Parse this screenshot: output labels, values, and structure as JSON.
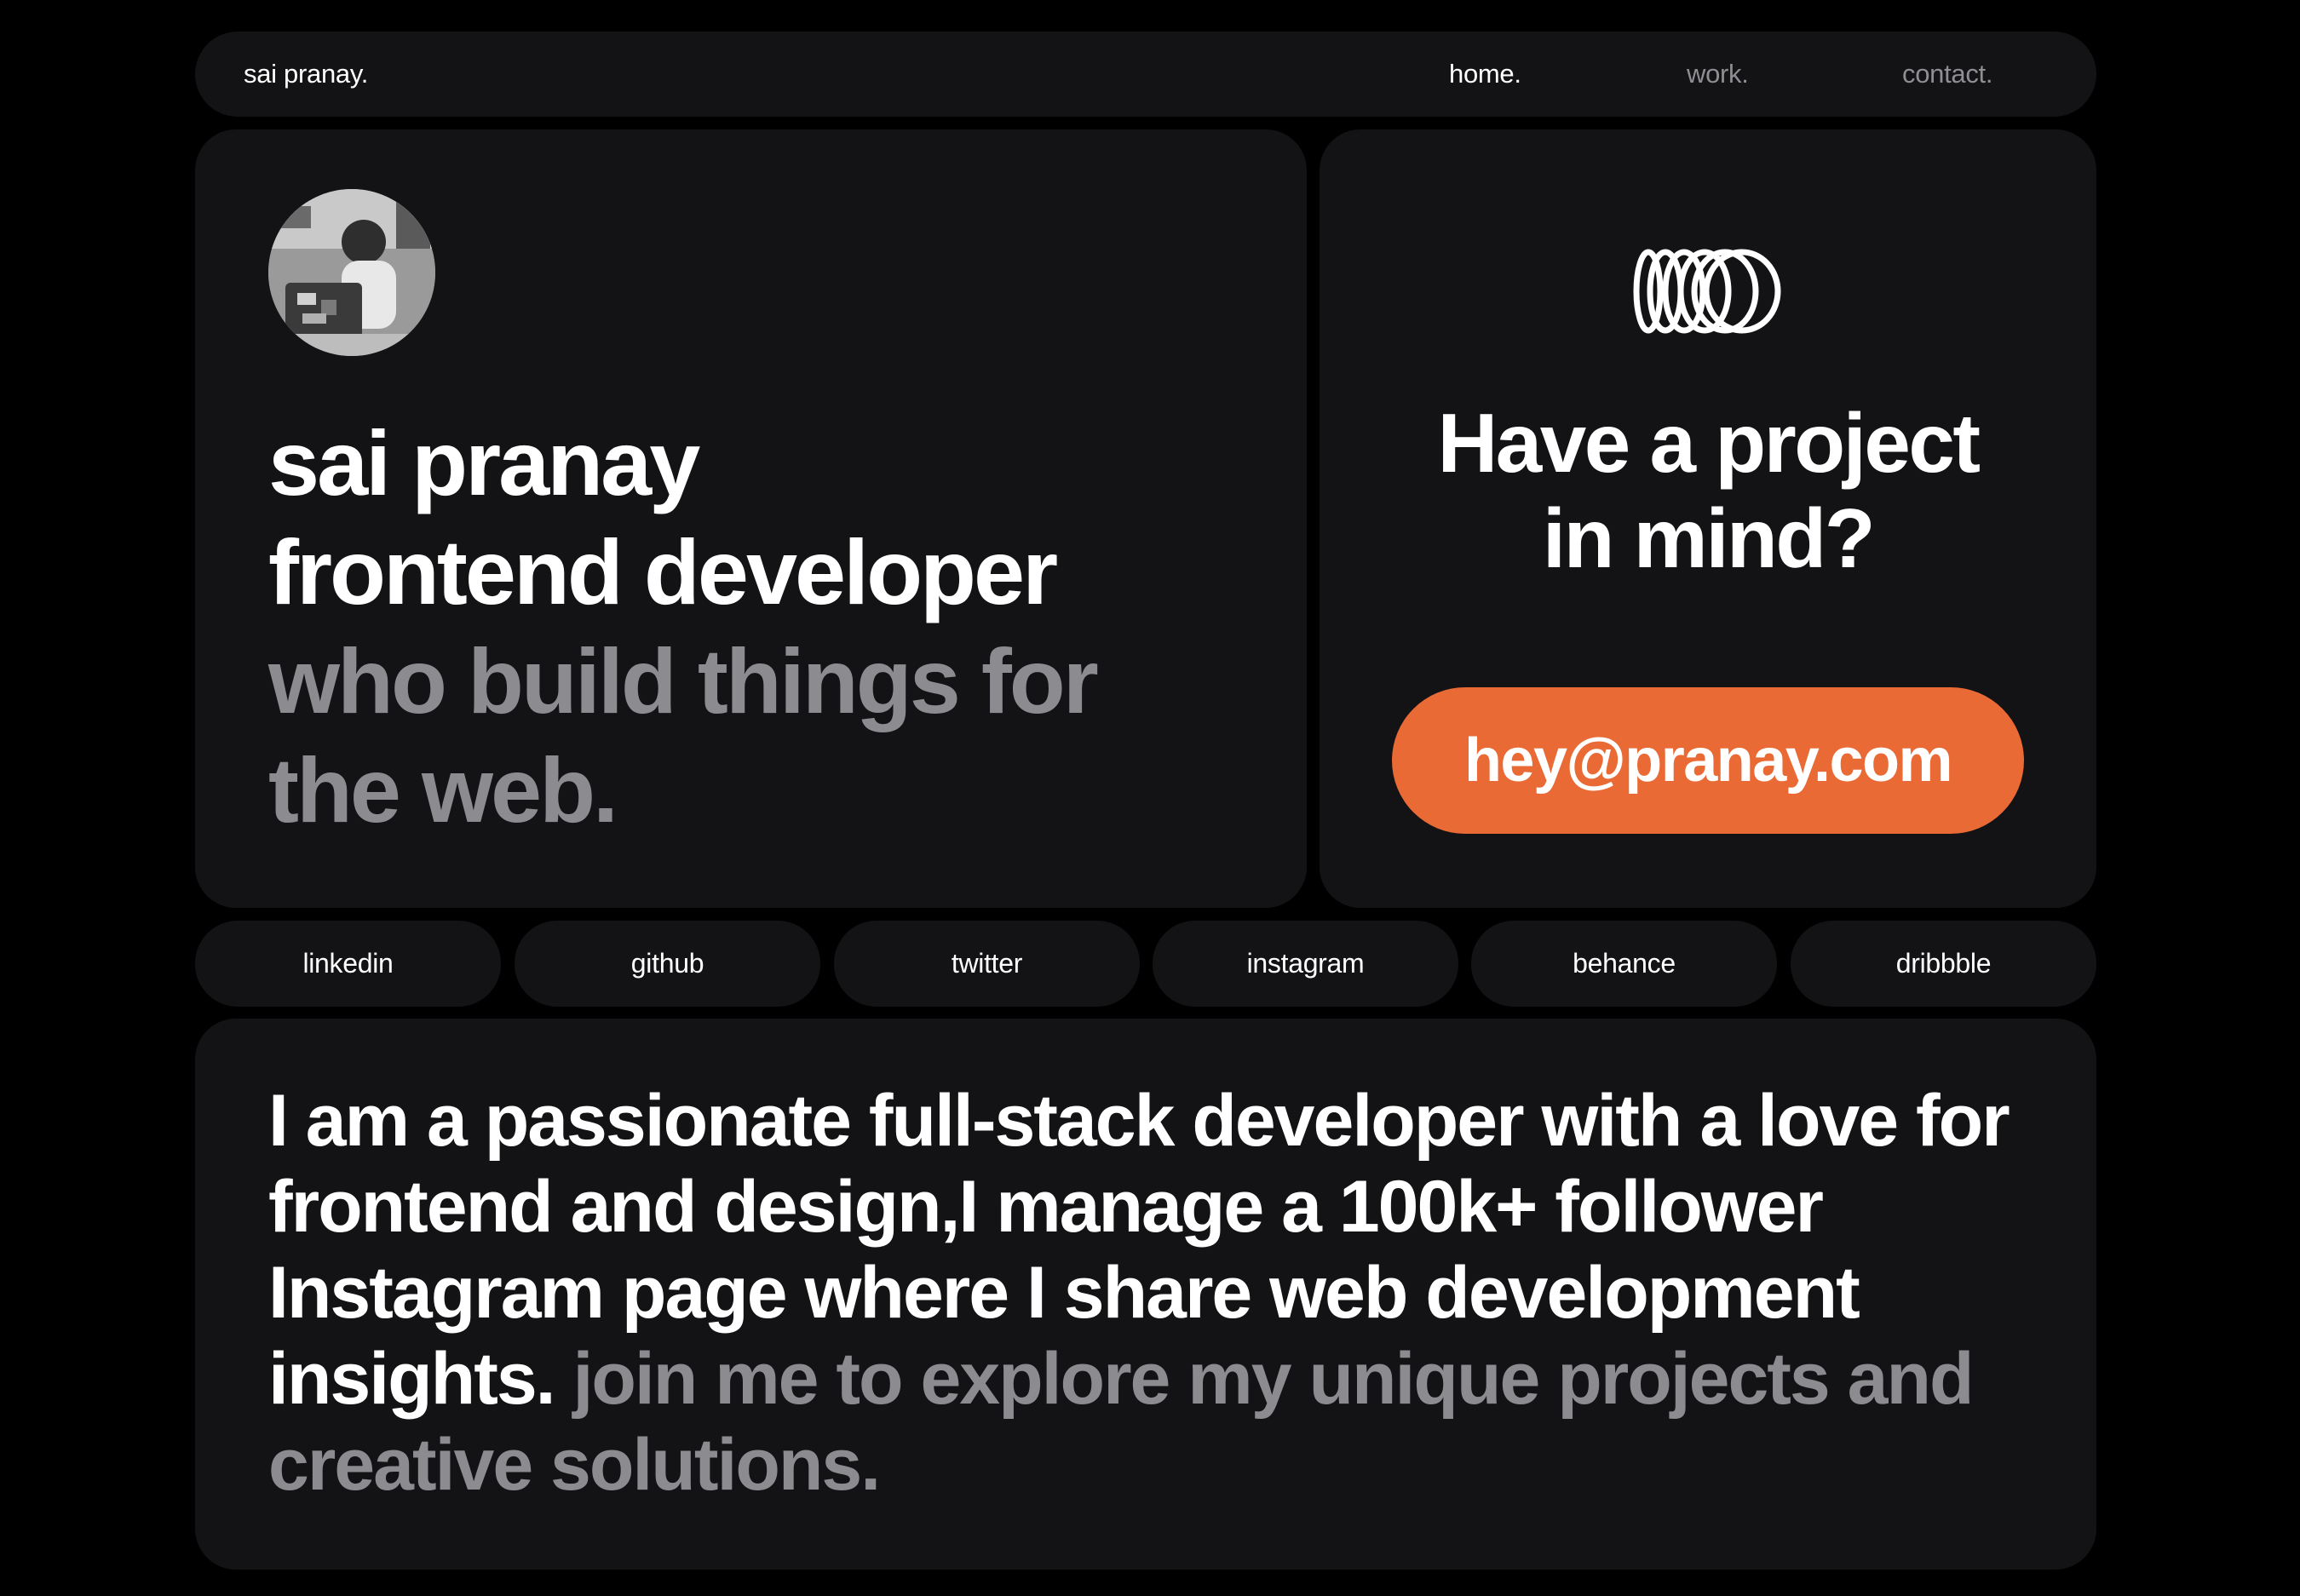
{
  "nav": {
    "brand": "sai pranay.",
    "links": [
      {
        "label": "home."
      },
      {
        "label": "work."
      },
      {
        "label": "contact."
      }
    ]
  },
  "hero": {
    "line1": "sai pranay",
    "line2": "frontend developer",
    "line3": "who build things for",
    "line4": "the web."
  },
  "contact": {
    "title_line1": "Have a project",
    "title_line2": "in mind?",
    "email": "hey@pranay.com"
  },
  "socials": [
    {
      "label": "linkedin"
    },
    {
      "label": "github"
    },
    {
      "label": "twitter"
    },
    {
      "label": "instagram"
    },
    {
      "label": "behance"
    },
    {
      "label": "dribbble"
    }
  ],
  "about": {
    "line1": "I am a passionate full-stack developer with a love for",
    "line2": "frontend and design,I manage a 100k+ follower",
    "line3": "Instagram page where I share web development",
    "line4_bright": "insights.",
    "line4_muted": " join me to explore my unique projects and",
    "line5_muted": "creative solutions."
  },
  "colors": {
    "background": "#000000",
    "card": "#131315",
    "accent": "#ea6a35",
    "muted_text": "#8b8b90",
    "text": "#ffffff"
  },
  "icons": {
    "brand_mark": "coil-icon",
    "profile": "avatar-photo"
  }
}
